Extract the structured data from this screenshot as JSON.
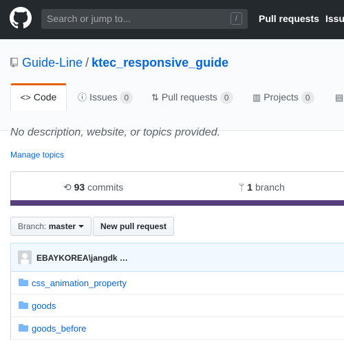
{
  "header": {
    "search_placeholder": "Search or jump to...",
    "slash_hint": "/",
    "nav": [
      "Pull requests",
      "Issues"
    ]
  },
  "repo": {
    "owner": "Guide-Line",
    "separator": "/",
    "name": "ktec_responsive_guide"
  },
  "tabs": [
    {
      "label": "Code",
      "icon": "code-icon",
      "selected": true
    },
    {
      "label": "Issues",
      "icon": "issue-icon",
      "count": "0"
    },
    {
      "label": "Pull requests",
      "icon": "pull-request-icon",
      "count": "0"
    },
    {
      "label": "Projects",
      "icon": "project-icon",
      "count": "0"
    }
  ],
  "main": {
    "description": "No description, website, or topics provided.",
    "manage_topics": "Manage topics",
    "summary": {
      "commits_count": "93",
      "commits_label": "commits",
      "branch_count": "1",
      "branch_label": "branch"
    },
    "branch_button": {
      "label": "Branch:",
      "value": "master"
    },
    "new_pr_button": "New pull request",
    "commit_author": "EBAYKOREA\\jangdk …",
    "files": [
      {
        "name": "css_animation_property",
        "type": "folder"
      },
      {
        "name": "goods",
        "type": "folder"
      },
      {
        "name": "goods_before",
        "type": "folder"
      }
    ]
  },
  "colors": {
    "header_bg": "#24292e",
    "link": "#0366d6",
    "accent_tab": "#e36209",
    "language_bar": "#563d7c"
  }
}
